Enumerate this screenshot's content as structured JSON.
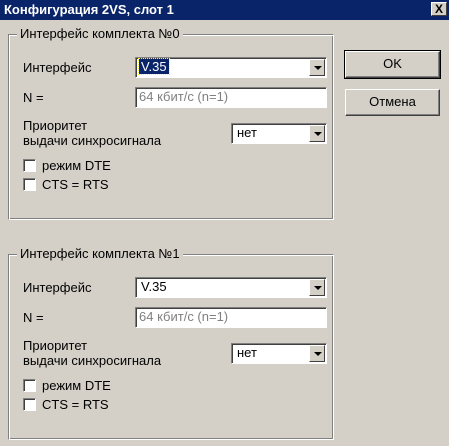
{
  "window": {
    "title": "Конфигурация 2VS, слот 1",
    "close_label": "X"
  },
  "groups": [
    {
      "legend": "Интерфейс комплекта №0",
      "interface_label": "Интерфейс",
      "interface_value": "V.35",
      "n_label": "N =",
      "n_value": "64 кбит/с (n=1)",
      "priority_label_line1": "Приоритет",
      "priority_label_line2": "выдачи синхросигнала",
      "priority_value": "нет",
      "dte_label": "режим DTE",
      "dte_checked": false,
      "cts_label": "CTS = RTS",
      "cts_checked": false
    },
    {
      "legend": "Интерфейс комплекта №1",
      "interface_label": "Интерфейс",
      "interface_value": "V.35",
      "n_label": "N =",
      "n_value": "64 кбит/с (n=1)",
      "priority_label_line1": "Приоритет",
      "priority_label_line2": "выдачи синхросигнала",
      "priority_value": "нет",
      "dte_label": "режим DTE",
      "dte_checked": false,
      "cts_label": "CTS = RTS",
      "cts_checked": false
    }
  ],
  "buttons": {
    "ok_label": "OK",
    "cancel_label": "Отмена"
  },
  "colors": {
    "titlebar": "#0a246a",
    "face": "#d4d0c8",
    "selection": "#0a246a"
  }
}
